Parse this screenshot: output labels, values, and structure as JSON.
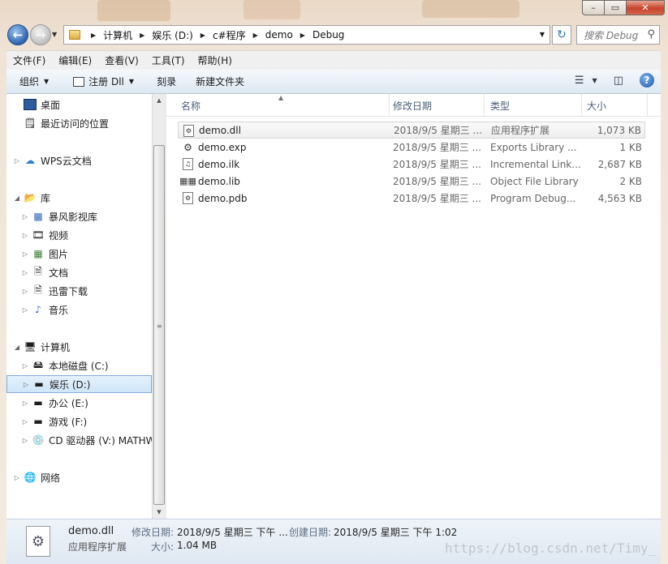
{
  "window": {
    "caption": {
      "min": "–",
      "max": "▭",
      "close": "✕"
    }
  },
  "address": {
    "segments": [
      "计算机",
      "娱乐 (D:)",
      "c#程序",
      "demo",
      "Debug"
    ],
    "refresh_icon": "refresh-icon"
  },
  "search": {
    "placeholder": "搜索 Debug"
  },
  "menu": [
    "文件(F)",
    "编辑(E)",
    "查看(V)",
    "工具(T)",
    "帮助(H)"
  ],
  "toolbar": {
    "organize": "组织",
    "register": "注册 Dll",
    "burn": "刻录",
    "new_folder": "新建文件夹"
  },
  "nav": {
    "desktop": "桌面",
    "recent": "最近访问的位置",
    "wps": "WPS云文档",
    "libraries": "库",
    "lib_items": [
      "暴风影视库",
      "视频",
      "图片",
      "文档",
      "迅雷下载",
      "音乐"
    ],
    "computer": "计算机",
    "drives": [
      "本地磁盘 (C:)",
      "娱乐 (D:)",
      "办公 (E:)",
      "游戏 (F:)",
      "CD 驱动器 (V:) MATHW"
    ],
    "network": "网络"
  },
  "columns": {
    "name": "名称",
    "date": "修改日期",
    "type": "类型",
    "size": "大小"
  },
  "files": [
    {
      "name": "demo.dll",
      "date": "2018/9/5 星期三 ...",
      "type": "应用程序扩展",
      "size": "1,073 KB",
      "icon": "dll-icon"
    },
    {
      "name": "demo.exp",
      "date": "2018/9/5 星期三 ...",
      "type": "Exports Library ...",
      "size": "1 KB",
      "icon": "exp-icon"
    },
    {
      "name": "demo.ilk",
      "date": "2018/9/5 星期三 ...",
      "type": "Incremental Link...",
      "size": "2,687 KB",
      "icon": "ilk-icon"
    },
    {
      "name": "demo.lib",
      "date": "2018/9/5 星期三 ...",
      "type": "Object File Library",
      "size": "2 KB",
      "icon": "lib-icon"
    },
    {
      "name": "demo.pdb",
      "date": "2018/9/5 星期三 ...",
      "type": "Program Debug...",
      "size": "4,563 KB",
      "icon": "pdb-icon"
    }
  ],
  "details": {
    "name": "demo.dll",
    "type": "应用程序扩展",
    "modified_label": "修改日期:",
    "modified": "2018/9/5 星期三 下午 ...",
    "created_label": "创建日期:",
    "created": "2018/9/5 星期三 下午 1:02",
    "size_label": "大小:",
    "size": "1.04 MB"
  },
  "watermark": "https://blog.csdn.net/Timy_"
}
